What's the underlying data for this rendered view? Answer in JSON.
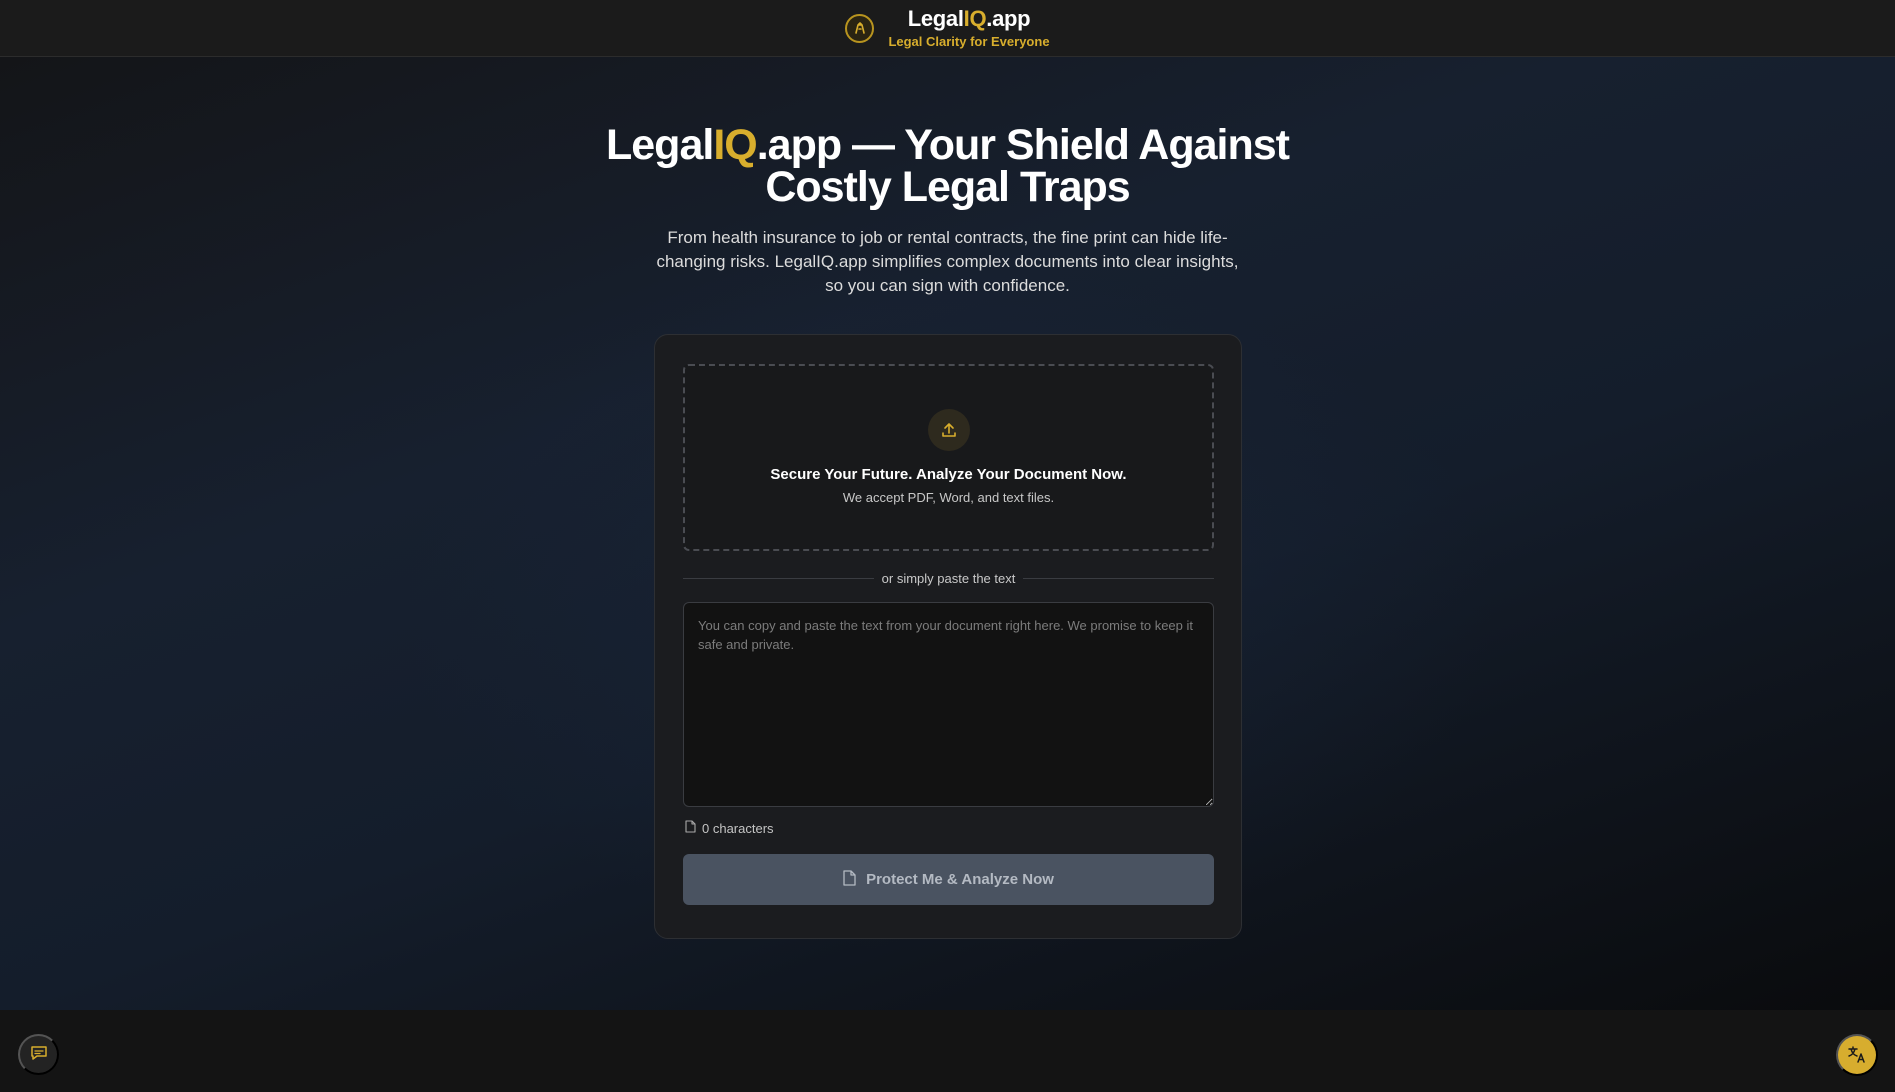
{
  "header": {
    "brand_prefix": "Legal",
    "brand_highlight": "IQ",
    "brand_suffix": ".app",
    "tagline": "Legal Clarity for Everyone",
    "logo_icon": "gavel-icon"
  },
  "hero": {
    "title_prefix": "Legal",
    "title_highlight": "IQ",
    "title_suffix": ".app — Your Shield Against Costly Legal Traps",
    "subtitle": "From health insurance to job or rental contracts, the fine print can hide life-changing risks. LegalIQ.app simplifies complex documents into clear insights, so you can sign with confidence."
  },
  "upload": {
    "icon": "upload-icon",
    "title": "Secure Your Future. Analyze Your Document Now.",
    "subtitle": "We accept PDF, Word, and text files."
  },
  "divider_text": "or simply paste the text",
  "paste": {
    "value": "",
    "placeholder": "You can copy and paste the text from your document right here. We promise to keep it safe and private."
  },
  "char_count": "0 characters",
  "analyze_button": "Protect Me & Analyze Now",
  "footer": {
    "feedback_icon": "message-icon",
    "translate_icon": "translate-icon"
  },
  "colors": {
    "accent": "#d8ae2d",
    "background": "#131313",
    "card": "#1b1c1f",
    "button_disabled": "#4a5361"
  }
}
